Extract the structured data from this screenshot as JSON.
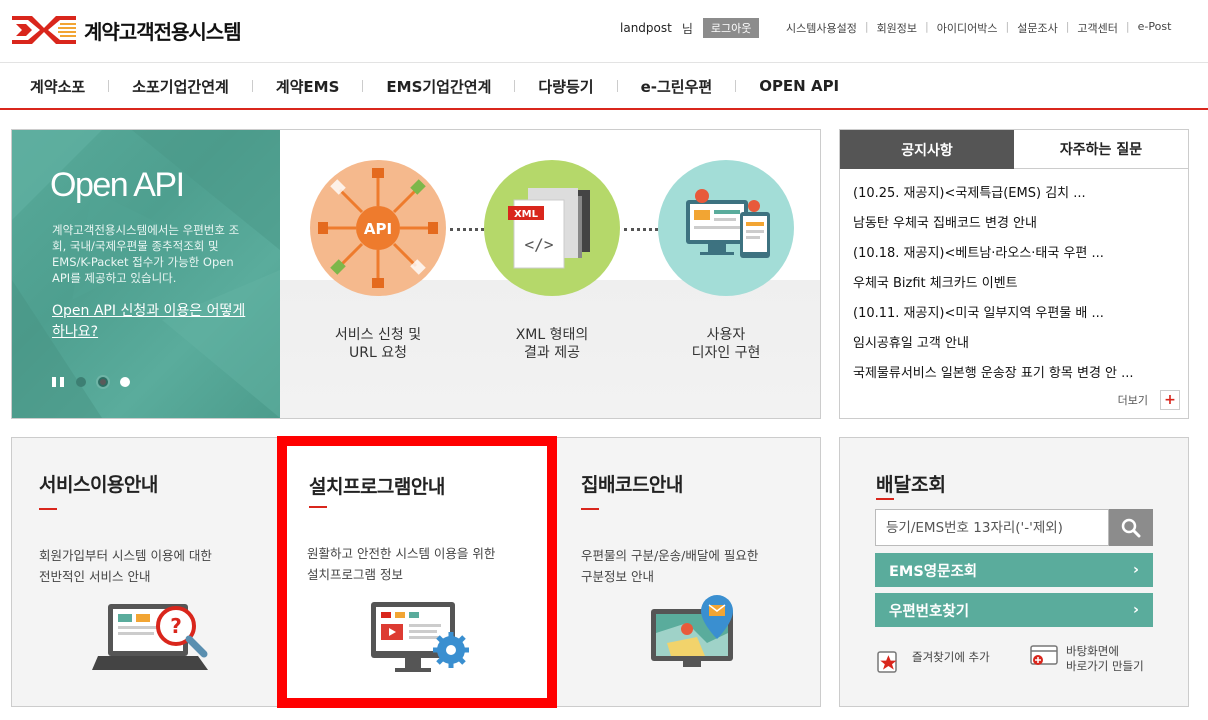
{
  "site": {
    "title": "계약고객전용시스템",
    "brand_color": "#d9261c",
    "accent_color": "#5aac9c"
  },
  "user": {
    "id": "landpost",
    "suffix": "님",
    "logout_label": "로그아웃"
  },
  "utility_nav": [
    {
      "label": "시스템사용설정"
    },
    {
      "label": "회원정보"
    },
    {
      "label": "아이디어박스"
    },
    {
      "label": "설문조사"
    },
    {
      "label": "고객센터"
    },
    {
      "label": "e-Post"
    }
  ],
  "gnb": [
    {
      "label": "계약소포"
    },
    {
      "label": "소포기업간연계"
    },
    {
      "label": "계약EMS"
    },
    {
      "label": "EMS기업간연계"
    },
    {
      "label": "다량등기"
    },
    {
      "label": "e-그린우편"
    },
    {
      "label": "OPEN API"
    }
  ],
  "banner": {
    "title": "Open API",
    "description": "계약고객전용시스템에서는 우편번호 조회, 국내/국제우편물 종추적조회 및 EMS/K-Packet 접수가 가능한 Open API를 제공하고 있습니다.",
    "link_label": "Open API 신청과 이용은 어떻게 하나요?",
    "steps": [
      {
        "label_line1": "서비스 신청 및",
        "label_line2": "URL 요청",
        "icon_text": "API",
        "icon": "api-hub-icon"
      },
      {
        "label_line1": "XML 형태의",
        "label_line2": "결과 제공",
        "icon_text": "XML",
        "icon": "xml-document-icon"
      },
      {
        "label_line1": "사용자",
        "label_line2": "디자인 구현",
        "icon": "devices-icon"
      }
    ]
  },
  "notice": {
    "tabs": [
      {
        "label": "공지사항",
        "active": true
      },
      {
        "label": "자주하는 질문",
        "active": false
      }
    ],
    "items": [
      {
        "title": "(10.25. 재공지)<국제특급(EMS) 김치 ..."
      },
      {
        "title": "남동탄 우체국 집배코드 변경 안내"
      },
      {
        "title": "(10.18. 재공지)<베트남·라오스·태국 우편 ..."
      },
      {
        "title": "우체국 Bizfit 체크카드 이벤트"
      },
      {
        "title": "(10.11. 재공지)<미국 일부지역 우편물 배 ..."
      },
      {
        "title": "임시공휴일 고객 안내"
      },
      {
        "title": "국제물류서비스 일본행 운송장 표기 항목 변경 안 ..."
      }
    ],
    "more_label": "더보기"
  },
  "cards": [
    {
      "title": "서비스이용안내",
      "desc_line1": "회원가입부터 시스템 이용에 대한",
      "desc_line2": "전반적인 서비스 안내",
      "icon": "laptop-help-icon"
    },
    {
      "title": "설치프로그램안내",
      "desc_line1": "원활하고 안전한 시스템 이용을 위한",
      "desc_line2": "설치프로그램 정보",
      "icon": "monitor-settings-icon"
    },
    {
      "title": "집배코드안내",
      "desc_line1": "우편물의 구분/운송/배달에 필요한",
      "desc_line2": "구분정보 안내",
      "icon": "map-location-icon"
    }
  ],
  "delivery": {
    "title": "배달조회",
    "search_placeholder": "등기/EMS번호 13자리('-'제외)",
    "buttons": [
      {
        "label": "EMS영문조회"
      },
      {
        "label": "우편번호찾기"
      }
    ],
    "quick": [
      {
        "label_line1": "즐겨찾기에 추가",
        "label_line2": ""
      },
      {
        "label_line1": "바탕화면에",
        "label_line2": "바로가기 만들기"
      }
    ]
  }
}
